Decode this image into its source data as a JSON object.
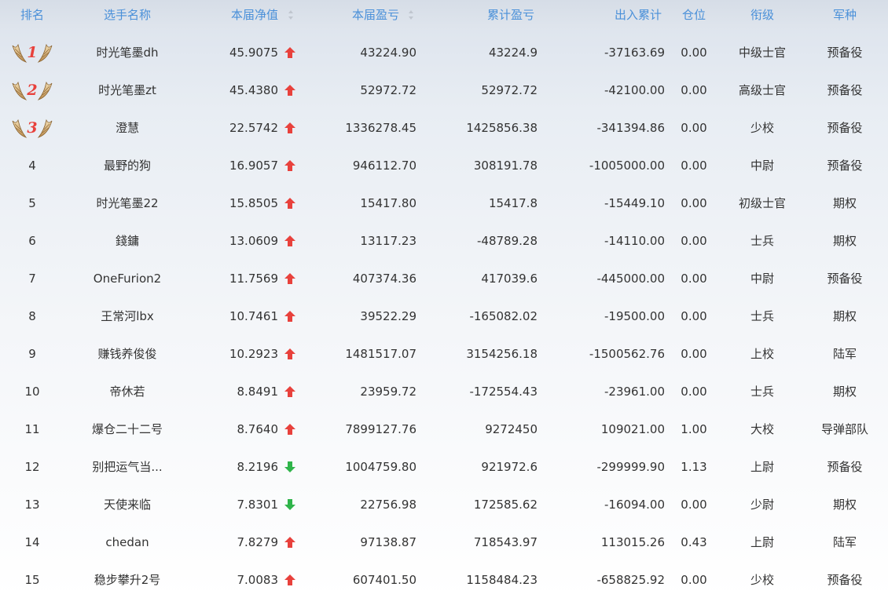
{
  "header": {
    "rank": "排名",
    "name": "选手名称",
    "net_value": "本届净值",
    "profit": "本届盈亏",
    "total_profit": "累计盈亏",
    "io_total": "出入累计",
    "position": "仓位",
    "title": "衔级",
    "branch": "军种"
  },
  "colors": {
    "header_text": "#4a90d9",
    "up_arrow": "#e8413c",
    "down_arrow": "#2fb44a",
    "medal_number": "#e8413c"
  },
  "icons": {
    "sort": "sort-updown-icon",
    "up": "arrow-up-icon",
    "down": "arrow-down-icon",
    "medal": "laurel-wings-medal-icon"
  },
  "rows": [
    {
      "rank": "1",
      "medal": true,
      "name": "时光笔墨dh",
      "net": "45.9075",
      "trend": "up",
      "profit": "43224.90",
      "total": "43224.9",
      "io": "-37163.69",
      "pos": "0.00",
      "title": "中级士官",
      "branch": "预备役"
    },
    {
      "rank": "2",
      "medal": true,
      "name": "时光笔墨zt",
      "net": "45.4380",
      "trend": "up",
      "profit": "52972.72",
      "total": "52972.72",
      "io": "-42100.00",
      "pos": "0.00",
      "title": "高级士官",
      "branch": "预备役"
    },
    {
      "rank": "3",
      "medal": true,
      "name": "澄慧",
      "net": "22.5742",
      "trend": "up",
      "profit": "1336278.45",
      "total": "1425856.38",
      "io": "-341394.86",
      "pos": "0.00",
      "title": "少校",
      "branch": "预备役"
    },
    {
      "rank": "4",
      "medal": false,
      "name": "最野的狗",
      "net": "16.9057",
      "trend": "up",
      "profit": "946112.70",
      "total": "308191.78",
      "io": "-1005000.00",
      "pos": "0.00",
      "title": "中尉",
      "branch": "预备役"
    },
    {
      "rank": "5",
      "medal": false,
      "name": "时光笔墨22",
      "net": "15.8505",
      "trend": "up",
      "profit": "15417.80",
      "total": "15417.8",
      "io": "-15449.10",
      "pos": "0.00",
      "title": "初级士官",
      "branch": "期权"
    },
    {
      "rank": "6",
      "medal": false,
      "name": "錢鏞",
      "net": "13.0609",
      "trend": "up",
      "profit": "13117.23",
      "total": "-48789.28",
      "io": "-14110.00",
      "pos": "0.00",
      "title": "士兵",
      "branch": "期权"
    },
    {
      "rank": "7",
      "medal": false,
      "name": "OneFurion2",
      "net": "11.7569",
      "trend": "up",
      "profit": "407374.36",
      "total": "417039.6",
      "io": "-445000.00",
      "pos": "0.00",
      "title": "中尉",
      "branch": "预备役"
    },
    {
      "rank": "8",
      "medal": false,
      "name": "王常河lbx",
      "net": "10.7461",
      "trend": "up",
      "profit": "39522.29",
      "total": "-165082.02",
      "io": "-19500.00",
      "pos": "0.00",
      "title": "士兵",
      "branch": "期权"
    },
    {
      "rank": "9",
      "medal": false,
      "name": "赚钱养俊俊",
      "net": "10.2923",
      "trend": "up",
      "profit": "1481517.07",
      "total": "3154256.18",
      "io": "-1500562.76",
      "pos": "0.00",
      "title": "上校",
      "branch": "陆军"
    },
    {
      "rank": "10",
      "medal": false,
      "name": "帝休若",
      "net": "8.8491",
      "trend": "up",
      "profit": "23959.72",
      "total": "-172554.43",
      "io": "-23961.00",
      "pos": "0.00",
      "title": "士兵",
      "branch": "期权"
    },
    {
      "rank": "11",
      "medal": false,
      "name": "爆仓二十二号",
      "net": "8.7640",
      "trend": "up",
      "profit": "7899127.76",
      "total": "9272450",
      "io": "109021.00",
      "pos": "1.00",
      "title": "大校",
      "branch": "导弹部队"
    },
    {
      "rank": "12",
      "medal": false,
      "name": "别把运气当...",
      "net": "8.2196",
      "trend": "down",
      "profit": "1004759.80",
      "total": "921972.6",
      "io": "-299999.90",
      "pos": "1.13",
      "title": "上尉",
      "branch": "预备役"
    },
    {
      "rank": "13",
      "medal": false,
      "name": "天使来临",
      "net": "7.8301",
      "trend": "down",
      "profit": "22756.98",
      "total": "172585.62",
      "io": "-16094.00",
      "pos": "0.00",
      "title": "少尉",
      "branch": "期权"
    },
    {
      "rank": "14",
      "medal": false,
      "name": "chedan",
      "net": "7.8279",
      "trend": "up",
      "profit": "97138.87",
      "total": "718543.97",
      "io": "113015.26",
      "pos": "0.43",
      "title": "上尉",
      "branch": "陆军"
    },
    {
      "rank": "15",
      "medal": false,
      "name": "稳步攀升2号",
      "net": "7.0083",
      "trend": "up",
      "profit": "607401.50",
      "total": "1158484.23",
      "io": "-658825.92",
      "pos": "0.00",
      "title": "少校",
      "branch": "预备役"
    }
  ]
}
